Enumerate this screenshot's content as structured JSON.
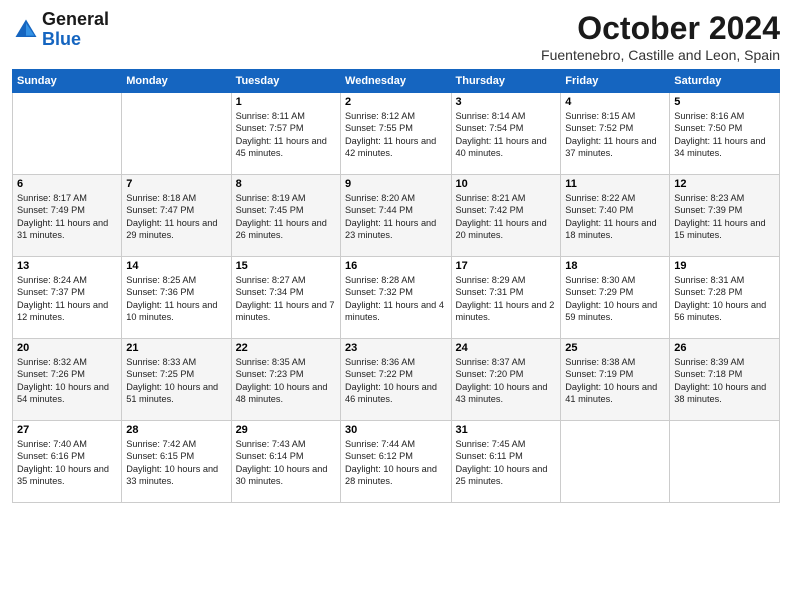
{
  "header": {
    "logo_line1": "General",
    "logo_line2": "Blue",
    "month_title": "October 2024",
    "location": "Fuentenebro, Castille and Leon, Spain"
  },
  "days_of_week": [
    "Sunday",
    "Monday",
    "Tuesday",
    "Wednesday",
    "Thursday",
    "Friday",
    "Saturday"
  ],
  "weeks": [
    [
      {
        "day": "",
        "info": ""
      },
      {
        "day": "",
        "info": ""
      },
      {
        "day": "1",
        "info": "Sunrise: 8:11 AM\nSunset: 7:57 PM\nDaylight: 11 hours and 45 minutes."
      },
      {
        "day": "2",
        "info": "Sunrise: 8:12 AM\nSunset: 7:55 PM\nDaylight: 11 hours and 42 minutes."
      },
      {
        "day": "3",
        "info": "Sunrise: 8:14 AM\nSunset: 7:54 PM\nDaylight: 11 hours and 40 minutes."
      },
      {
        "day": "4",
        "info": "Sunrise: 8:15 AM\nSunset: 7:52 PM\nDaylight: 11 hours and 37 minutes."
      },
      {
        "day": "5",
        "info": "Sunrise: 8:16 AM\nSunset: 7:50 PM\nDaylight: 11 hours and 34 minutes."
      }
    ],
    [
      {
        "day": "6",
        "info": "Sunrise: 8:17 AM\nSunset: 7:49 PM\nDaylight: 11 hours and 31 minutes."
      },
      {
        "day": "7",
        "info": "Sunrise: 8:18 AM\nSunset: 7:47 PM\nDaylight: 11 hours and 29 minutes."
      },
      {
        "day": "8",
        "info": "Sunrise: 8:19 AM\nSunset: 7:45 PM\nDaylight: 11 hours and 26 minutes."
      },
      {
        "day": "9",
        "info": "Sunrise: 8:20 AM\nSunset: 7:44 PM\nDaylight: 11 hours and 23 minutes."
      },
      {
        "day": "10",
        "info": "Sunrise: 8:21 AM\nSunset: 7:42 PM\nDaylight: 11 hours and 20 minutes."
      },
      {
        "day": "11",
        "info": "Sunrise: 8:22 AM\nSunset: 7:40 PM\nDaylight: 11 hours and 18 minutes."
      },
      {
        "day": "12",
        "info": "Sunrise: 8:23 AM\nSunset: 7:39 PM\nDaylight: 11 hours and 15 minutes."
      }
    ],
    [
      {
        "day": "13",
        "info": "Sunrise: 8:24 AM\nSunset: 7:37 PM\nDaylight: 11 hours and 12 minutes."
      },
      {
        "day": "14",
        "info": "Sunrise: 8:25 AM\nSunset: 7:36 PM\nDaylight: 11 hours and 10 minutes."
      },
      {
        "day": "15",
        "info": "Sunrise: 8:27 AM\nSunset: 7:34 PM\nDaylight: 11 hours and 7 minutes."
      },
      {
        "day": "16",
        "info": "Sunrise: 8:28 AM\nSunset: 7:32 PM\nDaylight: 11 hours and 4 minutes."
      },
      {
        "day": "17",
        "info": "Sunrise: 8:29 AM\nSunset: 7:31 PM\nDaylight: 11 hours and 2 minutes."
      },
      {
        "day": "18",
        "info": "Sunrise: 8:30 AM\nSunset: 7:29 PM\nDaylight: 10 hours and 59 minutes."
      },
      {
        "day": "19",
        "info": "Sunrise: 8:31 AM\nSunset: 7:28 PM\nDaylight: 10 hours and 56 minutes."
      }
    ],
    [
      {
        "day": "20",
        "info": "Sunrise: 8:32 AM\nSunset: 7:26 PM\nDaylight: 10 hours and 54 minutes."
      },
      {
        "day": "21",
        "info": "Sunrise: 8:33 AM\nSunset: 7:25 PM\nDaylight: 10 hours and 51 minutes."
      },
      {
        "day": "22",
        "info": "Sunrise: 8:35 AM\nSunset: 7:23 PM\nDaylight: 10 hours and 48 minutes."
      },
      {
        "day": "23",
        "info": "Sunrise: 8:36 AM\nSunset: 7:22 PM\nDaylight: 10 hours and 46 minutes."
      },
      {
        "day": "24",
        "info": "Sunrise: 8:37 AM\nSunset: 7:20 PM\nDaylight: 10 hours and 43 minutes."
      },
      {
        "day": "25",
        "info": "Sunrise: 8:38 AM\nSunset: 7:19 PM\nDaylight: 10 hours and 41 minutes."
      },
      {
        "day": "26",
        "info": "Sunrise: 8:39 AM\nSunset: 7:18 PM\nDaylight: 10 hours and 38 minutes."
      }
    ],
    [
      {
        "day": "27",
        "info": "Sunrise: 7:40 AM\nSunset: 6:16 PM\nDaylight: 10 hours and 35 minutes."
      },
      {
        "day": "28",
        "info": "Sunrise: 7:42 AM\nSunset: 6:15 PM\nDaylight: 10 hours and 33 minutes."
      },
      {
        "day": "29",
        "info": "Sunrise: 7:43 AM\nSunset: 6:14 PM\nDaylight: 10 hours and 30 minutes."
      },
      {
        "day": "30",
        "info": "Sunrise: 7:44 AM\nSunset: 6:12 PM\nDaylight: 10 hours and 28 minutes."
      },
      {
        "day": "31",
        "info": "Sunrise: 7:45 AM\nSunset: 6:11 PM\nDaylight: 10 hours and 25 minutes."
      },
      {
        "day": "",
        "info": ""
      },
      {
        "day": "",
        "info": ""
      }
    ]
  ]
}
